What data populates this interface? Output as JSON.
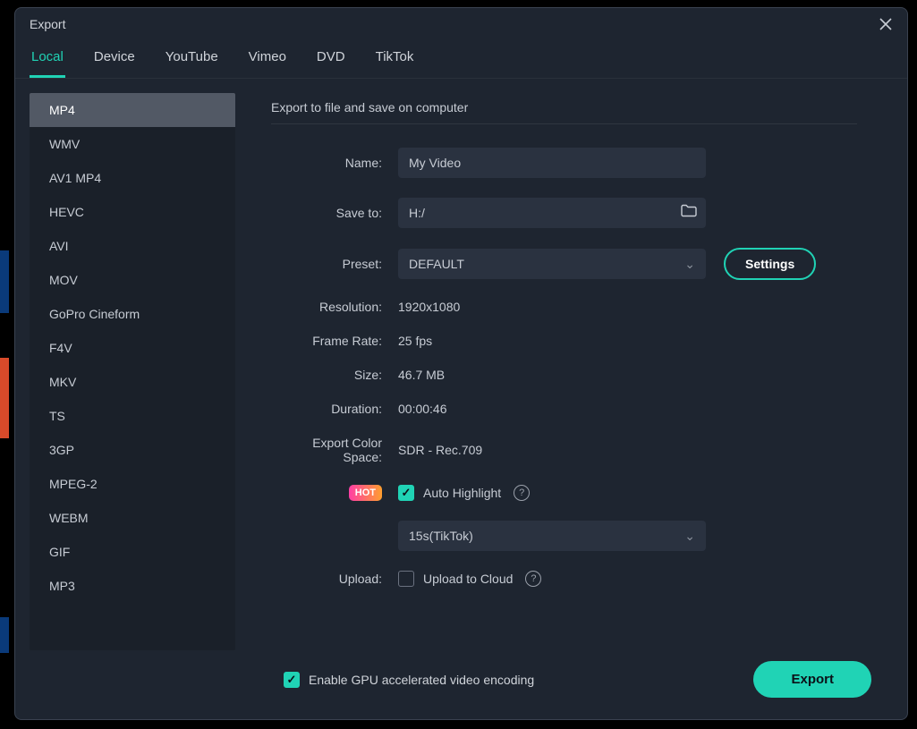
{
  "window": {
    "title": "Export"
  },
  "tabs": [
    "Local",
    "Device",
    "YouTube",
    "Vimeo",
    "DVD",
    "TikTok"
  ],
  "activeTab": 0,
  "formats": [
    "MP4",
    "WMV",
    "AV1 MP4",
    "HEVC",
    "AVI",
    "MOV",
    "GoPro Cineform",
    "F4V",
    "MKV",
    "TS",
    "3GP",
    "MPEG-2",
    "WEBM",
    "GIF",
    "MP3"
  ],
  "activeFormat": 0,
  "section_title": "Export to file and save on computer",
  "labels": {
    "name": "Name:",
    "save_to": "Save to:",
    "preset": "Preset:",
    "resolution": "Resolution:",
    "frame_rate": "Frame Rate:",
    "size": "Size:",
    "duration": "Duration:",
    "color_space": "Export Color Space:",
    "upload": "Upload:"
  },
  "values": {
    "name": "My Video",
    "save_to": "H:/",
    "preset": "DEFAULT",
    "resolution": "1920x1080",
    "frame_rate": "25 fps",
    "size": "46.7 MB",
    "duration": "00:00:46",
    "color_space": "SDR - Rec.709",
    "highlight_preset": "15s(TikTok)"
  },
  "settings_btn": "Settings",
  "hot_badge": "HOT",
  "auto_highlight_label": "Auto Highlight",
  "upload_cloud_label": "Upload to Cloud",
  "gpu_label": "Enable GPU accelerated video encoding",
  "export_btn": "Export"
}
